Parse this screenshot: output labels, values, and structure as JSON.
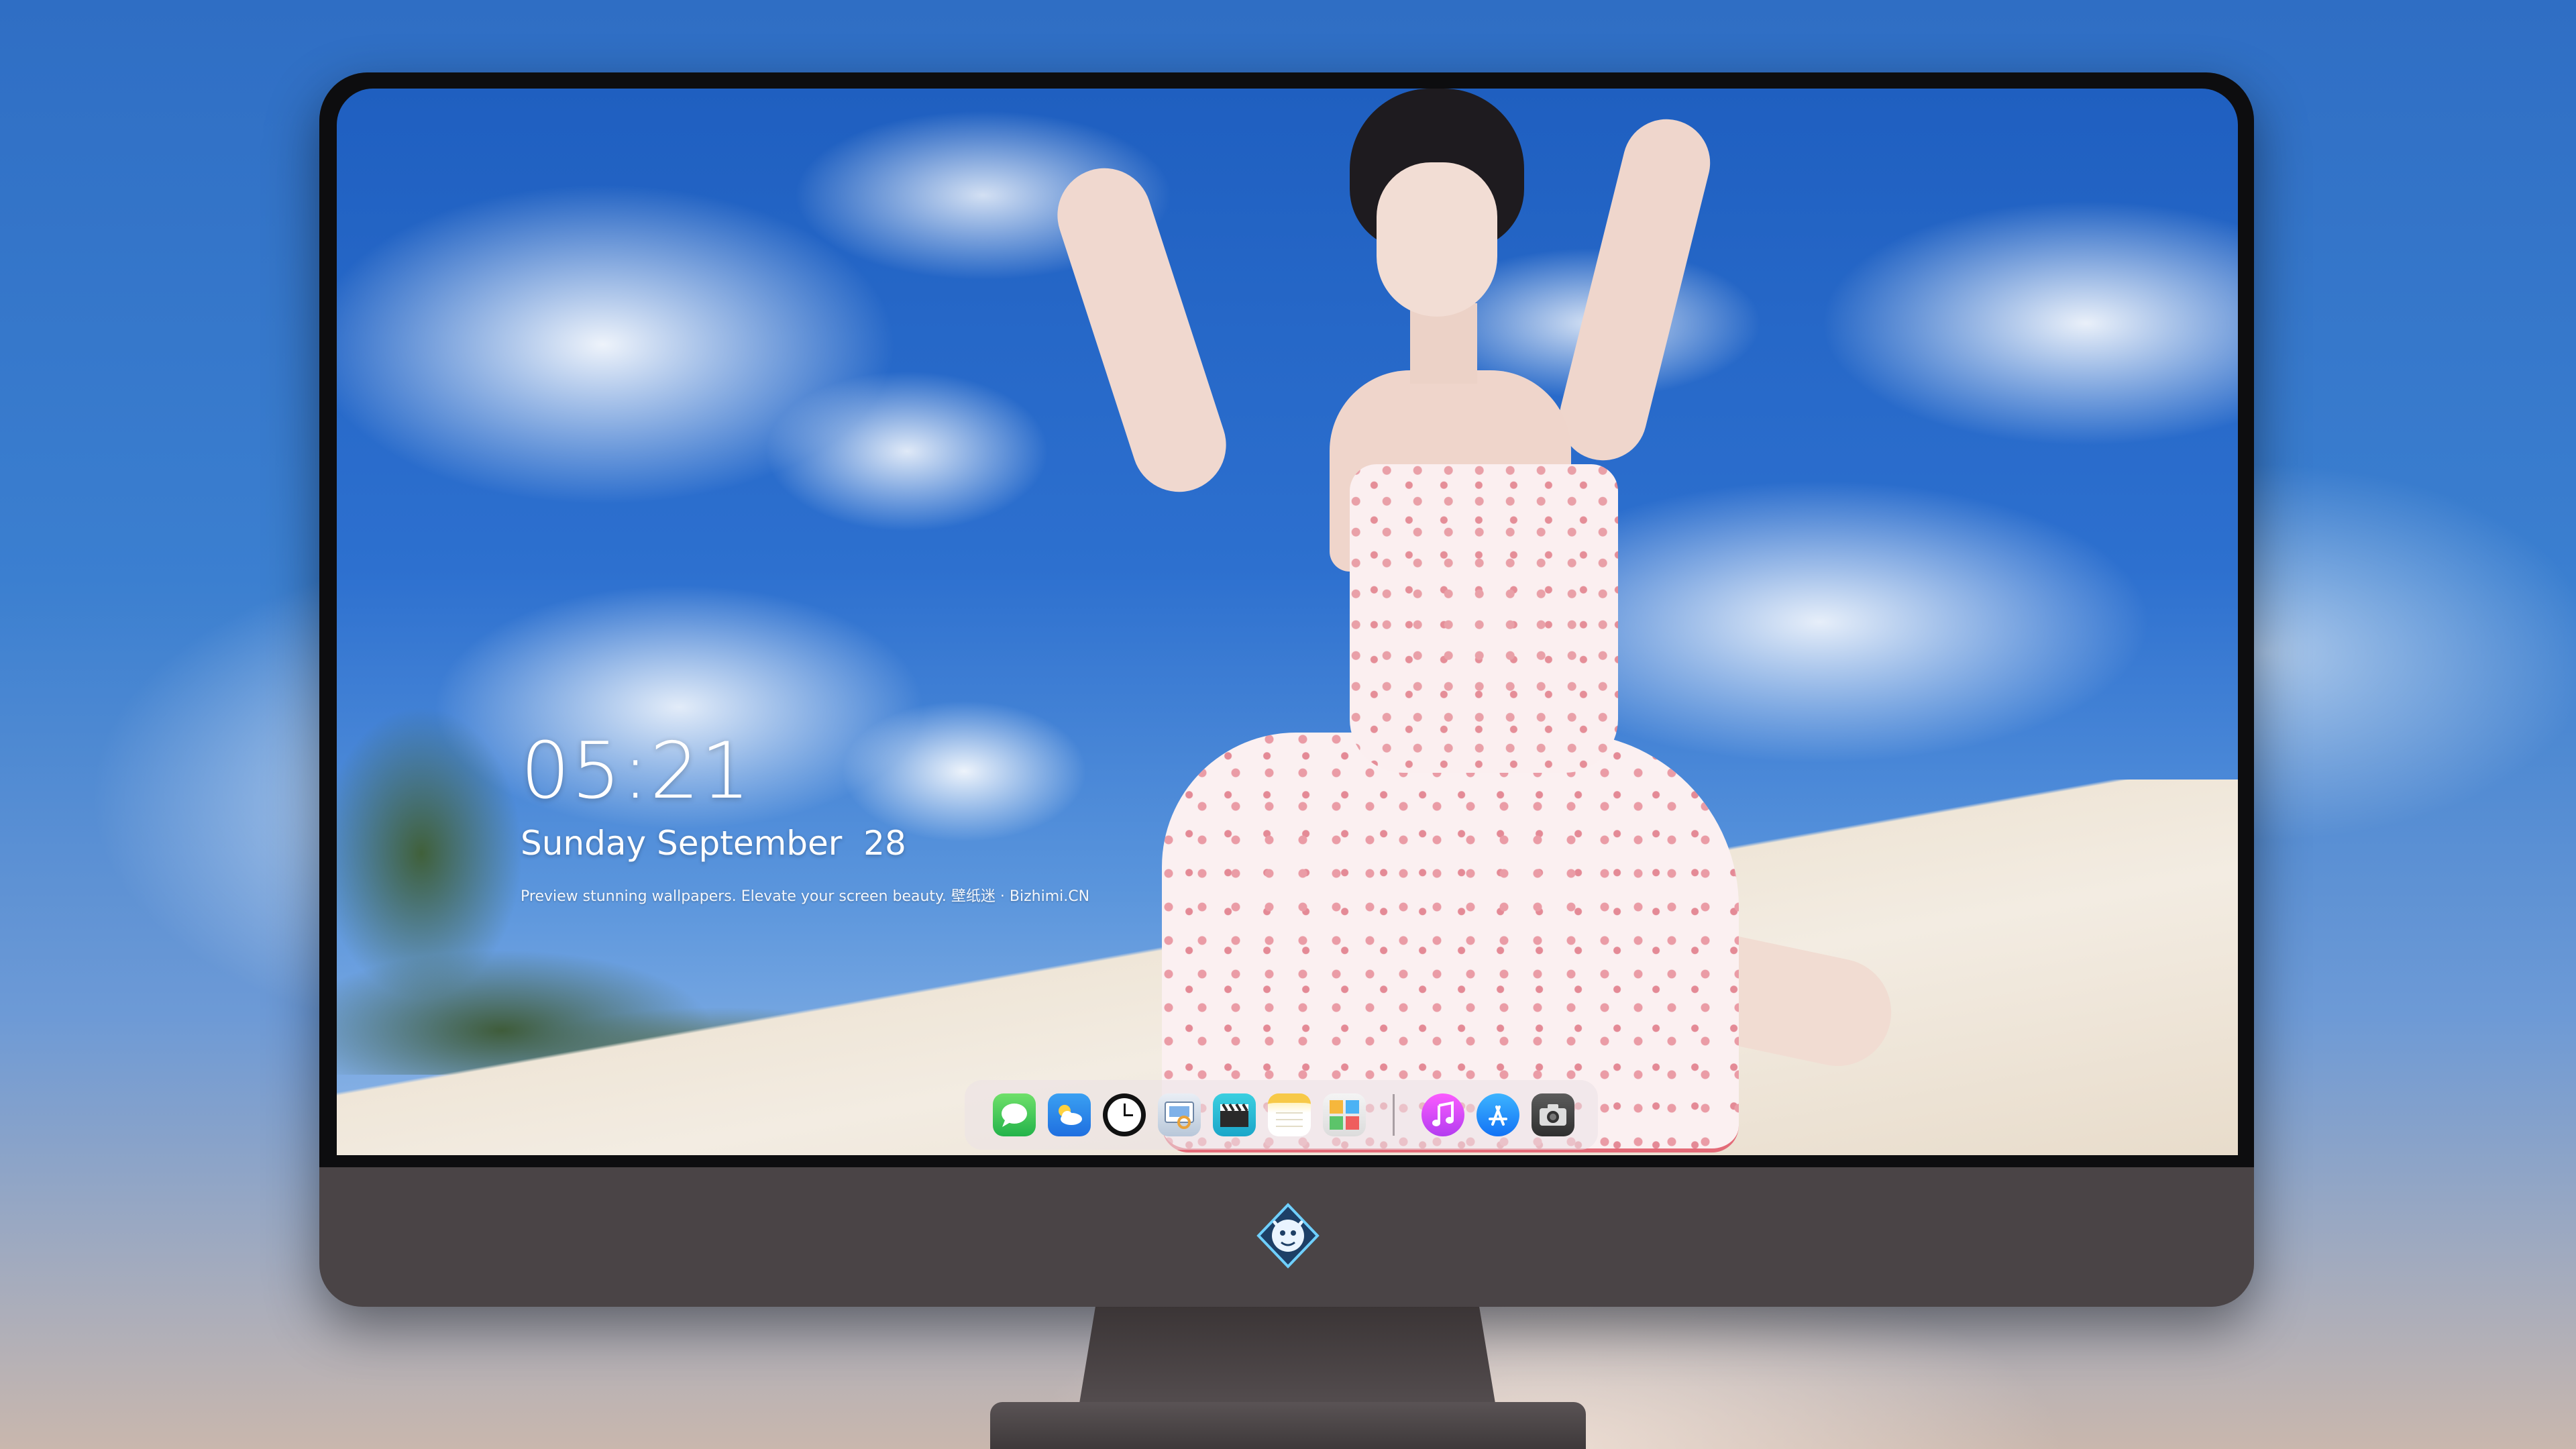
{
  "lockscreen": {
    "time": "05:21",
    "date": "Sunday September  28",
    "tagline": "Preview stunning wallpapers. Elevate your screen beauty. 壁纸迷 · Bizhimi.CN"
  },
  "dock": {
    "apps": [
      {
        "name": "Messages",
        "icon": "messages-icon"
      },
      {
        "name": "Weather",
        "icon": "weather-icon"
      },
      {
        "name": "Clock",
        "icon": "clock-icon"
      },
      {
        "name": "Preview",
        "icon": "preview-icon"
      },
      {
        "name": "Clips",
        "icon": "clapperboard-icon"
      },
      {
        "name": "Notes",
        "icon": "notes-icon"
      },
      {
        "name": "Photos",
        "icon": "photos-icon"
      },
      {
        "name": "Music",
        "icon": "music-icon"
      },
      {
        "name": "App Store",
        "icon": "app-store-icon"
      },
      {
        "name": "Camera",
        "icon": "camera-icon"
      }
    ]
  },
  "colors": {
    "sky": "#2d70cf",
    "monitor_chin": "#4a4446",
    "bezel": "#0d0d0f",
    "text": "#ffffff"
  }
}
